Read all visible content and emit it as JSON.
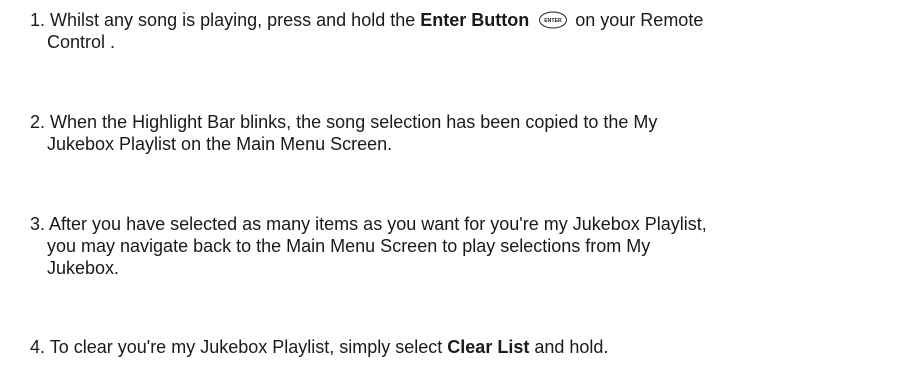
{
  "steps": [
    {
      "number": "1.",
      "line1_pre": "Whilst any song is playing, press and hold the",
      "line1_bold": "Enter Button",
      "line1_post": "on your Remote",
      "line2": "Control .",
      "icon": "enter-button-icon",
      "icon_label": "ENTER"
    },
    {
      "number": "2.",
      "line1": "When the Highlight Bar blinks, the song selection has been copied to the My",
      "line2": "Jukebox Playlist on the Main Menu Screen."
    },
    {
      "number": "3.",
      "line1": "After you have selected as many items as you want for you're my Jukebox Playlist,",
      "line2": "you may navigate back to the Main Menu Screen to play selections from My",
      "line3": "Jukebox."
    },
    {
      "number": "4.",
      "pre": "To clear you're my Jukebox Playlist, simply select",
      "bold": "Clear List",
      "post": "and hold."
    }
  ]
}
